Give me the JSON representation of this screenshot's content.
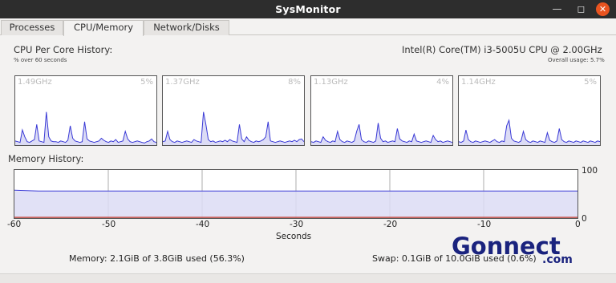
{
  "window": {
    "title": "SysMonitor",
    "minimize_glyph": "—",
    "maximize_glyph": "◻",
    "close_glyph": "✕"
  },
  "tabs": [
    {
      "label": "Processes"
    },
    {
      "label": "CPU/Memory"
    },
    {
      "label": "Network/Disks"
    }
  ],
  "cpu": {
    "heading": "CPU Per Core History:",
    "subheading": "% over 60 seconds",
    "model": "Intel(R) Core(TM) i3-5005U CPU @ 2.00GHz",
    "overall": "Overall usage: 5.7%",
    "cores": [
      {
        "freq": "1.49GHz",
        "usage": "5%",
        "history": [
          6,
          5,
          4,
          22,
          12,
          5,
          4,
          6,
          8,
          30,
          6,
          5,
          4,
          48,
          12,
          6,
          5,
          5,
          4,
          6,
          5,
          4,
          7,
          28,
          10,
          6,
          5,
          4,
          5,
          34,
          9,
          6,
          5,
          4,
          5,
          6,
          10,
          7,
          5,
          4,
          6,
          5,
          8,
          4,
          5,
          6,
          20,
          9,
          5,
          4,
          5,
          6,
          5,
          4,
          3,
          5,
          6,
          9,
          5,
          4
        ]
      },
      {
        "freq": "1.37GHz",
        "usage": "8%",
        "history": [
          5,
          6,
          20,
          8,
          5,
          4,
          6,
          5,
          4,
          5,
          6,
          5,
          4,
          8,
          6,
          5,
          4,
          48,
          30,
          8,
          5,
          6,
          4,
          5,
          6,
          5,
          7,
          5,
          8,
          6,
          5,
          4,
          30,
          9,
          5,
          12,
          7,
          5,
          4,
          6,
          5,
          6,
          8,
          12,
          34,
          6,
          5,
          4,
          5,
          6,
          5,
          4,
          5,
          6,
          5,
          7,
          5,
          8,
          9,
          5
        ]
      },
      {
        "freq": "1.13GHz",
        "usage": "4%",
        "history": [
          5,
          4,
          6,
          5,
          4,
          12,
          7,
          5,
          4,
          6,
          5,
          20,
          8,
          5,
          4,
          6,
          5,
          4,
          6,
          20,
          30,
          8,
          5,
          4,
          6,
          5,
          4,
          6,
          32,
          10,
          5,
          6,
          4,
          5,
          6,
          5,
          24,
          9,
          6,
          5,
          4,
          6,
          5,
          16,
          6,
          5,
          4,
          5,
          6,
          5,
          4,
          14,
          8,
          5,
          6,
          4,
          5,
          6,
          5,
          4
        ]
      },
      {
        "freq": "1.14GHz",
        "usage": "5%",
        "history": [
          5,
          4,
          6,
          22,
          8,
          5,
          4,
          6,
          5,
          4,
          5,
          6,
          5,
          4,
          6,
          8,
          5,
          4,
          6,
          5,
          28,
          36,
          10,
          6,
          5,
          4,
          6,
          20,
          8,
          5,
          4,
          6,
          5,
          4,
          6,
          5,
          4,
          18,
          7,
          5,
          4,
          6,
          24,
          8,
          5,
          4,
          6,
          5,
          4,
          6,
          5,
          4,
          6,
          5,
          4,
          6,
          5,
          4,
          6,
          5
        ]
      }
    ]
  },
  "memory": {
    "heading": "Memory History:",
    "usage_percent": 56.3,
    "swap_percent": 0.6,
    "y_max_label": "100",
    "y_min_label": "0",
    "x_ticks": [
      "-60",
      "-50",
      "-40",
      "-30",
      "-20",
      "-10",
      "0"
    ],
    "x_label": "Seconds",
    "memory_text": "Memory: 2.1GiB of 3.8GiB used (56.3%)",
    "swap_text": "Swap: 0.1GiB of 10.0GiB used (0.6%)"
  },
  "watermark": {
    "text": "Gonnect",
    "suffix": ".com"
  },
  "colors": {
    "fill": "#dcdcf5",
    "line": "#3a3ad6",
    "swap_line": "#c0392b",
    "grid": "#999999",
    "close_button": "#e95420",
    "logo": "#1a237e"
  }
}
